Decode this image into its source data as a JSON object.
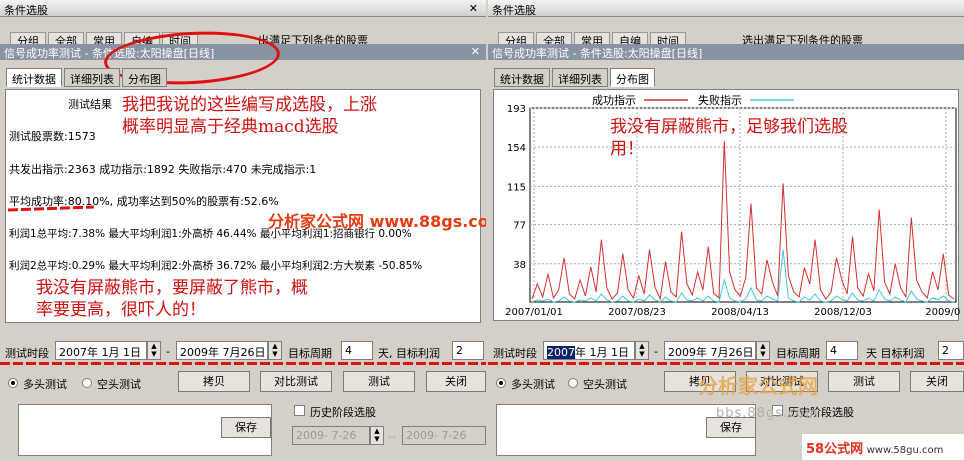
{
  "left": {
    "bg_title": "条件选股",
    "bg_tabs": [
      "分组",
      "全部",
      "常用",
      "自编",
      "时间"
    ],
    "bg_hint": "出满足下列条件的股票",
    "win_title": "信号成功率测试 - 条件选股:太阳操盘[日线]",
    "tabs": [
      "统计数据",
      "详细列表",
      "分布图"
    ],
    "results": {
      "heading": "测试结果",
      "line1": "测试股票数:1573",
      "line2": "共发出指示:2363 成功指示:1892 失败指示:470 未完成指示:1",
      "line3": "平均成功率:80.10%, 成功率达到50%的股票有:52.6%",
      "line4": "利润1总平均:7.38% 最大平均利润1:外高桥    46.44% 最小平均利润1:招商银行 0.00%",
      "line5": "利润2总平均:0.29% 最大平均利润2:外高桥    36.72% 最小平均利润2:方大炭素 -50.85%"
    },
    "annotation_top": "我把我说的这些编写成选股，上涨\n概率明显高于经典macd选股",
    "annotation_bottom": "我没有屏蔽熊市，要屏蔽了熊市，概\n率要更高，很吓人的！",
    "watermark": "分析家公式网  www.88gs.com",
    "controls": {
      "period_label": "测试时段",
      "start_date": "2007年 1月 1日",
      "dash": "-",
      "end_date": "2009年 7月26日",
      "target_period_label": "目标周期",
      "target_period_value": "4",
      "target_profit_label": "天, 目标利润",
      "target_profit_value": "2",
      "radio_long": "多头测试",
      "radio_short": "空头测试",
      "btn_copy": "拷贝",
      "btn_compare": "对比测试",
      "btn_test": "测试",
      "btn_close": "关闭",
      "btn_save": "保存",
      "history_label": "历史阶段选股",
      "date_a": "2009- 7-26",
      "date_sep": "--",
      "date_b": "2009- 7-26"
    }
  },
  "right": {
    "bg_title": "条件选股",
    "bg_tabs": [
      "分组",
      "全部",
      "常用",
      "自编",
      "时间"
    ],
    "bg_hint": "选出满足下列条件的股票",
    "win_title": "信号成功率测试 - 条件选股:太阳操盘[日线]",
    "tabs": [
      "统计数据",
      "详细列表",
      "分布图"
    ],
    "annotation": "我没有屏蔽熊市，足够我们选股\n用！",
    "watermark": "分析家公式网",
    "watermark_url": "bbs.88gs.com",
    "logo_text": "58公式网",
    "logo_url": "www.58gu.com",
    "controls": {
      "period_label": "测试时段",
      "start_date_year": "2007",
      "start_date_rest": "年  1月  1日",
      "dash": "-",
      "end_date": "2009年 7月26日",
      "target_period_label": "目标周期",
      "target_period_value": "4",
      "target_profit_label": "天  目标利润",
      "target_profit_value": "2",
      "radio_long": "多头测试",
      "radio_short": "空头测试",
      "btn_copy": "拷贝",
      "btn_compare": "对比测试",
      "btn_test": "测试",
      "btn_close": "关闭",
      "btn_save": "保存",
      "history_label": "历史阶段选股"
    }
  },
  "chart_data": {
    "type": "line",
    "legend_position": "top",
    "series": [
      {
        "name": "成功指示",
        "color": "#d43030",
        "values": [
          3,
          18,
          5,
          28,
          4,
          12,
          44,
          8,
          3,
          22,
          6,
          35,
          10,
          62,
          14,
          3,
          9,
          48,
          12,
          4,
          26,
          8,
          52,
          15,
          3,
          40,
          10,
          5,
          70,
          18,
          7,
          30,
          12,
          55,
          9,
          4,
          160,
          30,
          12,
          6,
          24,
          98,
          14,
          8,
          42,
          20,
          6,
          118,
          26,
          10,
          5,
          34,
          18,
          62,
          12,
          3,
          10,
          44,
          22,
          8,
          65,
          14,
          6,
          28,
          11,
          92,
          20,
          8,
          38,
          14,
          5,
          84,
          22,
          10,
          4,
          30,
          12,
          48,
          7,
          3
        ]
      },
      {
        "name": "失败指示",
        "color": "#40c8d8",
        "values": [
          0,
          2,
          1,
          3,
          0,
          1,
          5,
          1,
          0,
          2,
          1,
          4,
          1,
          8,
          2,
          0,
          1,
          6,
          1,
          0,
          3,
          1,
          7,
          2,
          0,
          5,
          1,
          0,
          9,
          2,
          1,
          4,
          1,
          6,
          1,
          0,
          22,
          4,
          1,
          0,
          3,
          14,
          2,
          1,
          6,
          3,
          1,
          52,
          4,
          1,
          0,
          5,
          2,
          8,
          1,
          0,
          1,
          6,
          3,
          1,
          9,
          2,
          1,
          4,
          1,
          12,
          3,
          1,
          5,
          2,
          0,
          11,
          3,
          1,
          0,
          4,
          2,
          6,
          1,
          0
        ]
      }
    ],
    "yticks": [
      38,
      77,
      115,
      154,
      193
    ],
    "ylim": [
      0,
      193
    ],
    "xticks": [
      "2007/01/01",
      "2007/08/23",
      "2008/04/13",
      "2008/12/03",
      "2009/07"
    ],
    "grid": "dashed"
  }
}
